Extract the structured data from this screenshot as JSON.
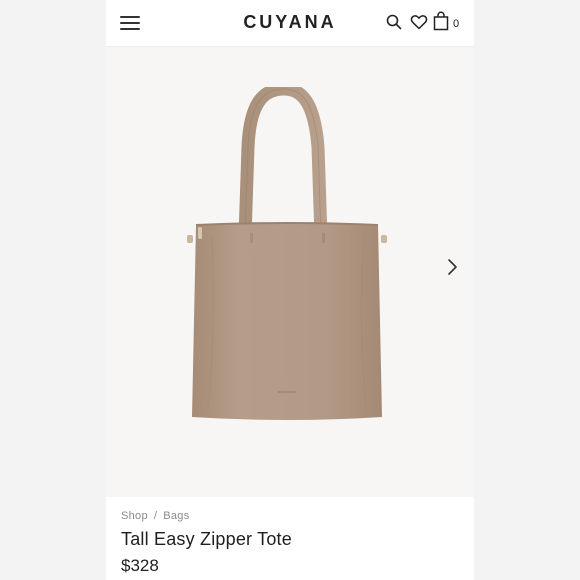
{
  "header": {
    "brand": "CUYANA",
    "cart_count": "0",
    "icons": [
      "menu-icon",
      "search-icon",
      "heart-icon",
      "shopping-bag-icon"
    ]
  },
  "gallery": {
    "next_icon": "chevron-right-icon",
    "product_color": "#b39a85"
  },
  "breadcrumb": {
    "items": [
      "Shop",
      "Bags"
    ],
    "separator": "/"
  },
  "product": {
    "name": "Tall Easy Zipper Tote",
    "price": "$328"
  }
}
